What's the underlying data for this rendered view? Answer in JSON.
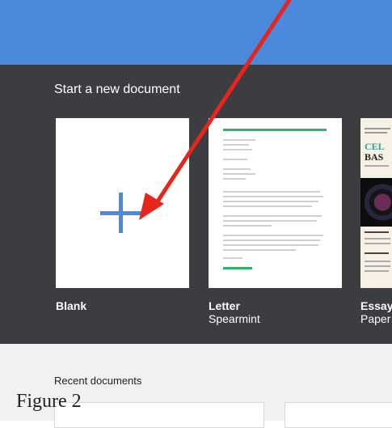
{
  "gallery": {
    "title": "Start a new document"
  },
  "templates": [
    {
      "name": "Blank",
      "subtitle": ""
    },
    {
      "name": "Letter",
      "subtitle": "Spearmint"
    },
    {
      "name": "Essay",
      "subtitle": "Paper"
    }
  ],
  "essay_preview": {
    "heading_line1": "CEL",
    "heading_line2": "BAS"
  },
  "recent": {
    "title": "Recent documents"
  },
  "caption": "Figure 2",
  "colors": {
    "header": "#4a89dc",
    "gallery_bg": "#3c3d40",
    "arrow": "#e8251b",
    "accent_green": "#2db36a"
  }
}
